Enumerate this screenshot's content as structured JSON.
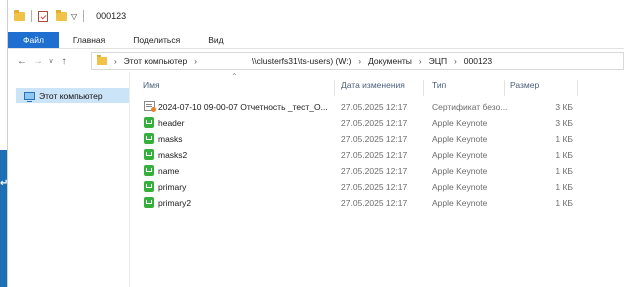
{
  "window": {
    "title": "000123"
  },
  "ribbon": {
    "tabs": [
      "Файл",
      "Главная",
      "Поделиться",
      "Вид"
    ]
  },
  "address": {
    "crumbs": [
      "Этот компьютер",
      "\\\\clusterfs31\\ts-users) (W:)",
      "Документы",
      "ЭЦП",
      "000123"
    ]
  },
  "navpane": {
    "items": [
      {
        "label": "Этот компьютер",
        "icon": "computer-icon"
      }
    ]
  },
  "columns": {
    "name": "Имя",
    "date": "Дата изменения",
    "type": "Тип",
    "size": "Размер"
  },
  "files": [
    {
      "name": "2024-07-10 09-00-07 Отчетность _тест_О...",
      "date": "27.05.2025 12:17",
      "type": "Сертификат безо...",
      "size": "3 КБ",
      "icon": "certificate-icon"
    },
    {
      "name": "header",
      "date": "27.05.2025 12:17",
      "type": "Apple Keynote",
      "size": "3 КБ",
      "icon": "keynote-icon"
    },
    {
      "name": "masks",
      "date": "27.05.2025 12:17",
      "type": "Apple Keynote",
      "size": "1 КБ",
      "icon": "keynote-icon"
    },
    {
      "name": "masks2",
      "date": "27.05.2025 12:17",
      "type": "Apple Keynote",
      "size": "1 КБ",
      "icon": "keynote-icon"
    },
    {
      "name": "name",
      "date": "27.05.2025 12:17",
      "type": "Apple Keynote",
      "size": "1 КБ",
      "icon": "keynote-icon"
    },
    {
      "name": "primary",
      "date": "27.05.2025 12:17",
      "type": "Apple Keynote",
      "size": "1 КБ",
      "icon": "keynote-icon"
    },
    {
      "name": "primary2",
      "date": "27.05.2025 12:17",
      "type": "Apple Keynote",
      "size": "1 КБ",
      "icon": "keynote-icon"
    }
  ],
  "colors": {
    "accent": "#1e6fd0",
    "selection": "#cce4f7",
    "keynote": "#35b03c",
    "folder": "#f0c24a"
  }
}
